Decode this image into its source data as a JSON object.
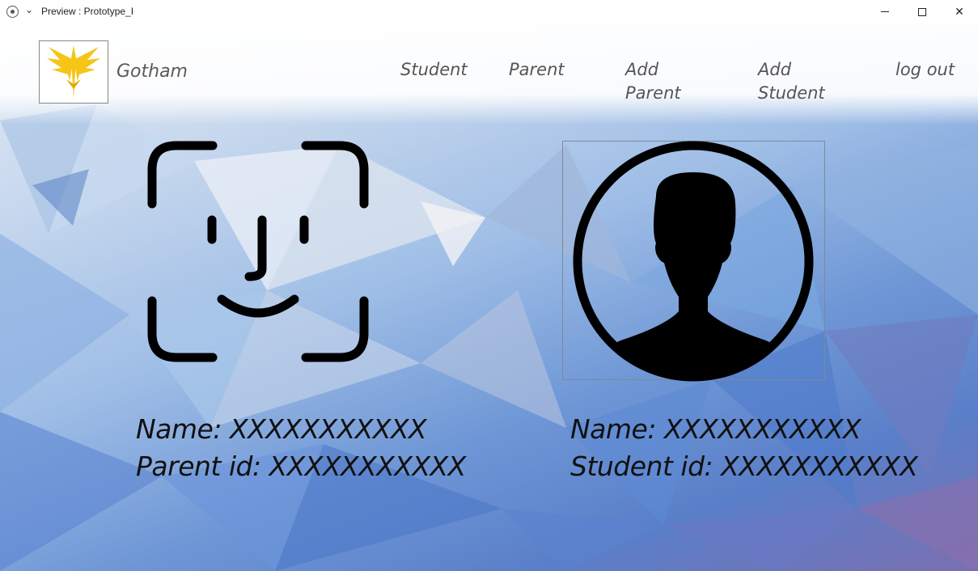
{
  "window": {
    "title": "Preview : Prototype_I"
  },
  "header": {
    "brand": "Gotham",
    "nav": {
      "student": "Student",
      "parent": "Parent",
      "add_parent_line1": "Add",
      "add_parent_line2": "Parent",
      "add_student_line1": "Add",
      "add_student_line2": "Student",
      "logout": "log out"
    }
  },
  "parent_card": {
    "name_label": "Name:",
    "name_value": "XXXXXXXXXXX",
    "id_label": "Parent id:",
    "id_value": "XXXXXXXXXXX"
  },
  "student_card": {
    "name_label": "Name:",
    "name_value": "XXXXXXXXXXX",
    "id_label": "Student id:",
    "id_value": "XXXXXXXXXXX"
  },
  "colors": {
    "logo_gold": "#f5c518",
    "nav_text": "#555555",
    "info_text": "#111111"
  },
  "icons": {
    "logo": "winged-emblem-icon",
    "face": "face-id-icon",
    "avatar": "user-avatar-icon"
  }
}
